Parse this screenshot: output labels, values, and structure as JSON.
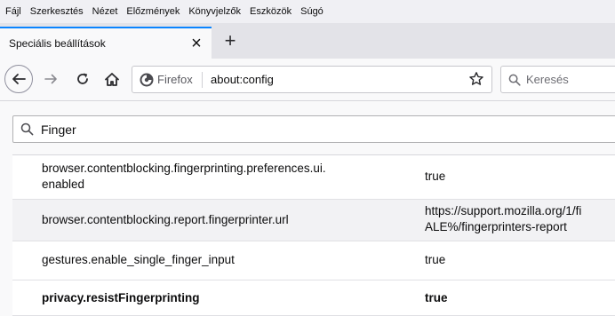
{
  "menu": {
    "items": [
      "Fájl",
      "Szerkesztés",
      "Nézet",
      "Előzmények",
      "Könyvjelzők",
      "Eszközök",
      "Súgó"
    ]
  },
  "tabs": {
    "active_title": "Speciális beállítások",
    "close_symbol": "×",
    "new_tab_symbol": "+"
  },
  "navbar": {
    "identity_label": "Firefox",
    "url": "about:config",
    "search_placeholder": "Keresés",
    "icons": {
      "back": "back-arrow-icon",
      "forward": "forward-arrow-icon",
      "reload": "reload-icon",
      "home": "home-icon",
      "identity": "firefox-icon",
      "bookmark": "star-icon",
      "search": "search-icon"
    }
  },
  "config": {
    "search_value": "Finger",
    "prefs": [
      {
        "name_line1": "browser.contentblocking.fingerprinting.preferences.ui.",
        "name_line2": "enabled",
        "value_line1": "true",
        "value_line2": "",
        "bold": false
      },
      {
        "name_line1": "browser.contentblocking.report.fingerprinter.url",
        "name_line2": "",
        "value_line1": "https://support.mozilla.org/1/fi",
        "value_line2": "ALE%/fingerprinters-report",
        "bold": false
      },
      {
        "name_line1": "gestures.enable_single_finger_input",
        "name_line2": "",
        "value_line1": "true",
        "value_line2": "",
        "bold": false
      },
      {
        "name_line1": "privacy.resistFingerprinting",
        "name_line2": "",
        "value_line1": "true",
        "value_line2": "",
        "bold": true
      }
    ]
  },
  "colors": {
    "accent": "#0a84ff",
    "tabstrip": "#e3e3e8",
    "menubar": "#f0f0f4"
  }
}
